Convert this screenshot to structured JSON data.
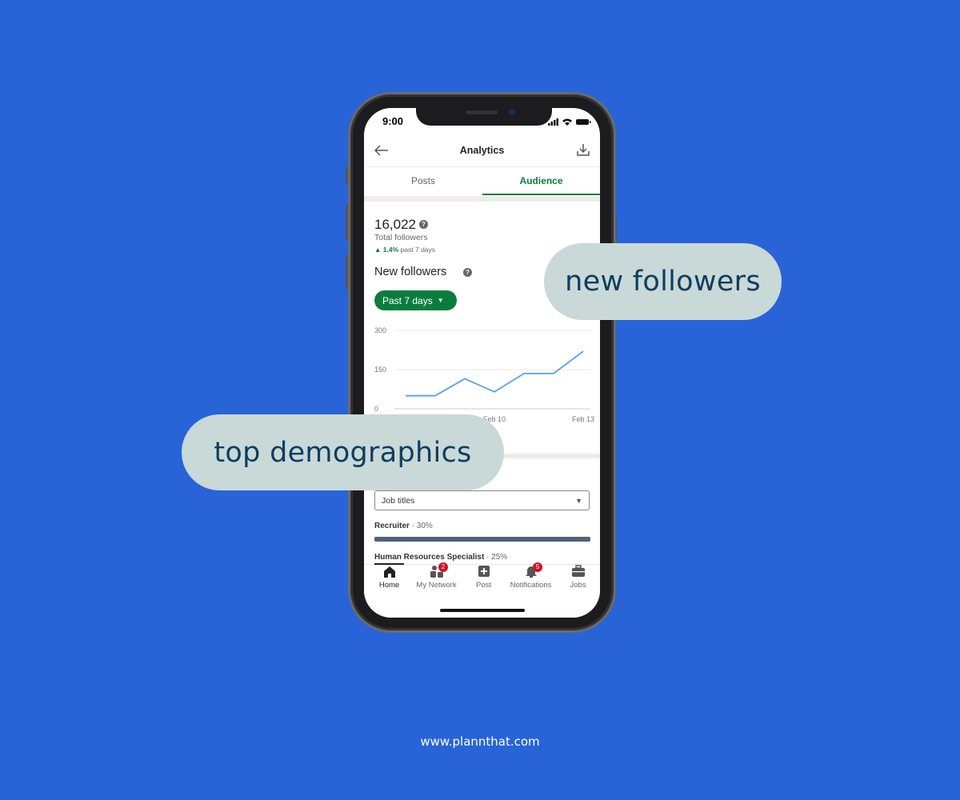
{
  "status_bar": {
    "time": "9:00"
  },
  "header": {
    "title": "Analytics",
    "back_icon": "arrow-left-icon",
    "download_icon": "download-icon"
  },
  "tabs": [
    {
      "label": "Posts",
      "active": false
    },
    {
      "label": "Audience",
      "active": true
    }
  ],
  "summary": {
    "total": "16,022",
    "total_label": "Total followers",
    "change": "1.4%",
    "change_label": "past 7 days"
  },
  "new_followers": {
    "title": "New followers",
    "range_button": "Past 7 days"
  },
  "chart_data": {
    "type": "line",
    "x_tick_labels": [
      "Feb 10",
      "Feb 13"
    ],
    "y_ticks": [
      0,
      150,
      300
    ],
    "ylim": [
      0,
      300
    ],
    "values": [
      50,
      50,
      115,
      65,
      135,
      135,
      220
    ],
    "grid": true,
    "line_color": "#5aa0ee"
  },
  "demographics": {
    "select_value": "Job titles",
    "items": [
      {
        "label": "Recruiter",
        "percent": "30%",
        "value": 30
      },
      {
        "label": "Human Resources Specialist",
        "percent": "25%",
        "value": 25
      }
    ]
  },
  "bottom_nav": [
    {
      "label": "Home",
      "icon": "home-icon",
      "badge": ""
    },
    {
      "label": "My Network",
      "icon": "network-icon",
      "badge": "2"
    },
    {
      "label": "Post",
      "icon": "plus-square-icon",
      "badge": ""
    },
    {
      "label": "Notifications",
      "icon": "bell-icon",
      "badge": "5"
    },
    {
      "label": "Jobs",
      "icon": "briefcase-icon",
      "badge": ""
    }
  ],
  "callouts": {
    "new_followers": "new followers",
    "top_demographics": "top demographics"
  },
  "footer": {
    "url": "www.plannthat.com"
  },
  "colors": {
    "background": "#2864d8",
    "accent_green": "#0a7d3e",
    "callout_bg": "#c9d9d8",
    "callout_text": "#0e3d5e"
  }
}
